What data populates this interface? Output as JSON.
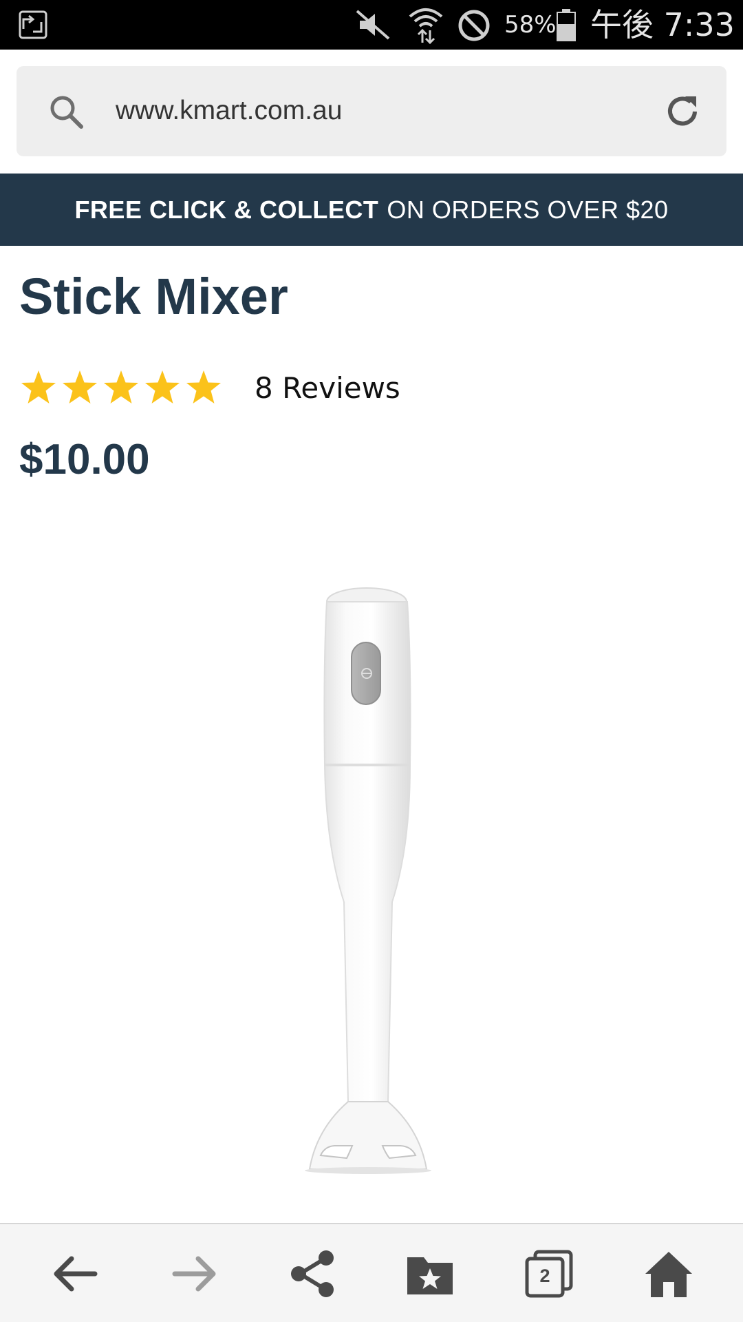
{
  "status_bar": {
    "battery_percent": "58%",
    "clock": "午後 7:33",
    "icons": [
      "app-switch-icon",
      "mute-icon",
      "wifi-icon",
      "do-not-disturb-icon",
      "battery-icon"
    ]
  },
  "browser": {
    "url": "www.kmart.com.au",
    "icons": [
      "search-icon",
      "reload-icon"
    ]
  },
  "promo": {
    "strong": "FREE CLICK & COLLECT",
    "rest": "ON ORDERS OVER $20"
  },
  "product": {
    "title": "Stick Mixer",
    "rating_value": 5,
    "rating_max": 5,
    "reviews": "8 Reviews",
    "price": "$10.00",
    "image_icon": "stick-mixer-image"
  },
  "bottom_nav": {
    "tabs_count": "2",
    "icons": [
      "back-arrow-icon",
      "forward-arrow-icon",
      "share-icon",
      "bookmarks-icon",
      "tabs-icon",
      "home-icon"
    ]
  },
  "colors": {
    "brand_navy": "#23384a",
    "star_gold": "#fbc21a",
    "status_bar_bg": "#000000",
    "url_box_bg": "#eeeeee",
    "nav_bg": "#f5f5f5"
  }
}
